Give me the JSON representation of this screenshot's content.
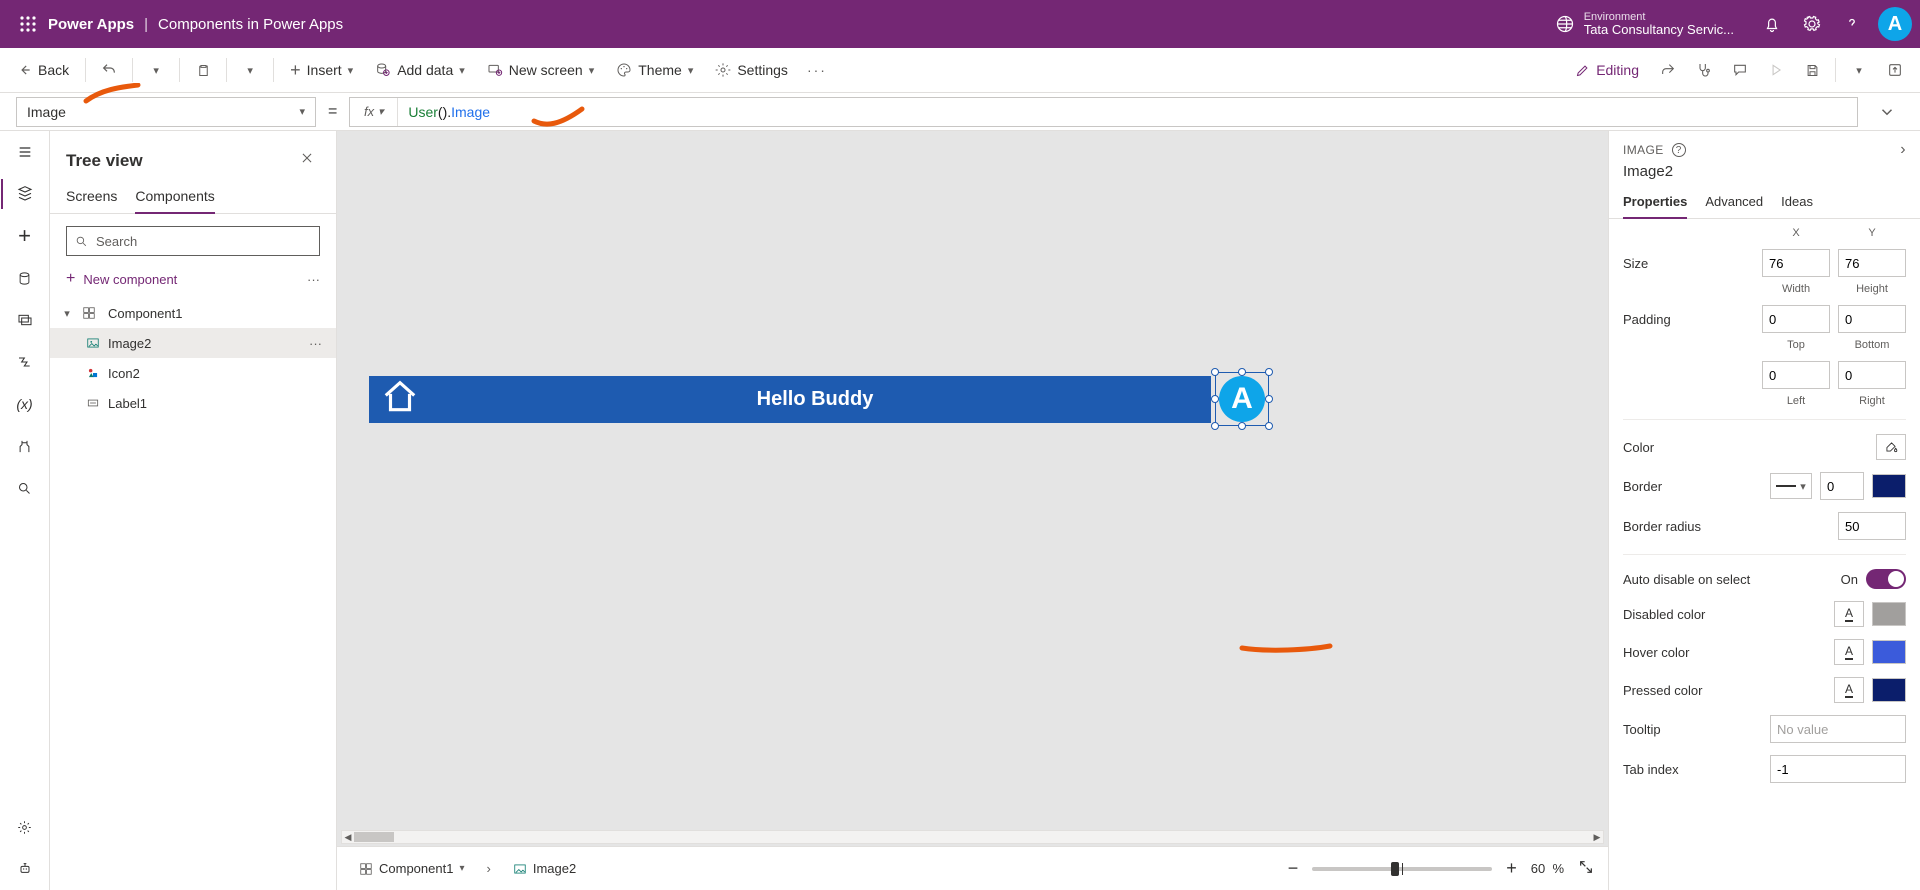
{
  "topbar": {
    "app_name": "Power Apps",
    "separator": "|",
    "file_name": "Components in Power Apps",
    "env_label": "Environment",
    "env_name": "Tata Consultancy Servic...",
    "avatar_letter": "A"
  },
  "cmdbar": {
    "back": "Back",
    "insert": "Insert",
    "add_data": "Add data",
    "new_screen": "New screen",
    "theme": "Theme",
    "settings": "Settings",
    "editing": "Editing"
  },
  "formula": {
    "property": "Image",
    "fx_user": "User",
    "fx_paren": "()",
    "fx_dot": ".",
    "fx_prop": "Image"
  },
  "treeview": {
    "title": "Tree view",
    "tab_screens": "Screens",
    "tab_components": "Components",
    "search_placeholder": "Search",
    "new_component": "New component",
    "items": {
      "component1": "Component1",
      "image2": "Image2",
      "icon2": "Icon2",
      "label1": "Label1"
    }
  },
  "canvas": {
    "hello_text": "Hello Buddy",
    "avatar_letter": "A"
  },
  "status": {
    "crumb1": "Component1",
    "crumb2": "Image2",
    "zoom_value": "60",
    "zoom_pct": "%"
  },
  "props": {
    "type_label": "IMAGE",
    "name": "Image2",
    "tab_properties": "Properties",
    "tab_advanced": "Advanced",
    "tab_ideas": "Ideas",
    "xy_x": "X",
    "xy_y": "Y",
    "size_label": "Size",
    "size_w": "76",
    "size_h": "76",
    "size_wlabel": "Width",
    "size_hlabel": "Height",
    "padding_label": "Padding",
    "pad_top": "0",
    "pad_right": "0",
    "pad_top_l": "Top",
    "pad_bottom_l": "Bottom",
    "pad_left": "0",
    "pad_bottom": "0",
    "pad_left_l": "Left",
    "pad_right_l": "Right",
    "color_label": "Color",
    "border_label": "Border",
    "border_val": "0",
    "radius_label": "Border radius",
    "radius_val": "50",
    "auto_disable": "Auto disable on select",
    "auto_on": "On",
    "disabled_color": "Disabled color",
    "hover_color": "Hover color",
    "pressed_color": "Pressed color",
    "tooltip": "Tooltip",
    "tooltip_val": "No value",
    "tabindex": "Tab index",
    "tabindex_val": "-1"
  }
}
